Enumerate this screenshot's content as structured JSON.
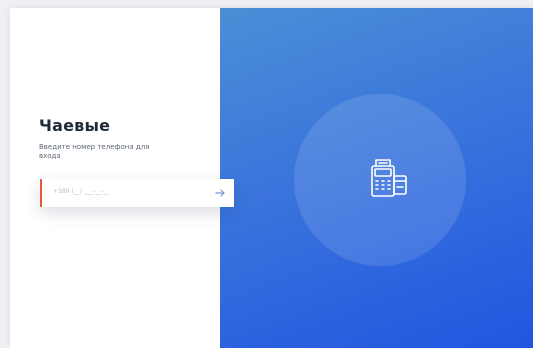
{
  "login": {
    "title": "Чаевые",
    "subtitle": "Введите номер телефона для входа",
    "phone_placeholder": "+380 (__) ___-__-__"
  },
  "icons": {
    "submit": "arrow-right-icon",
    "hero": "payment-terminal-icon"
  },
  "colors": {
    "accent": "#e35a3c",
    "gradient_start": "#4a8fd6",
    "gradient_end": "#1f56e0"
  }
}
